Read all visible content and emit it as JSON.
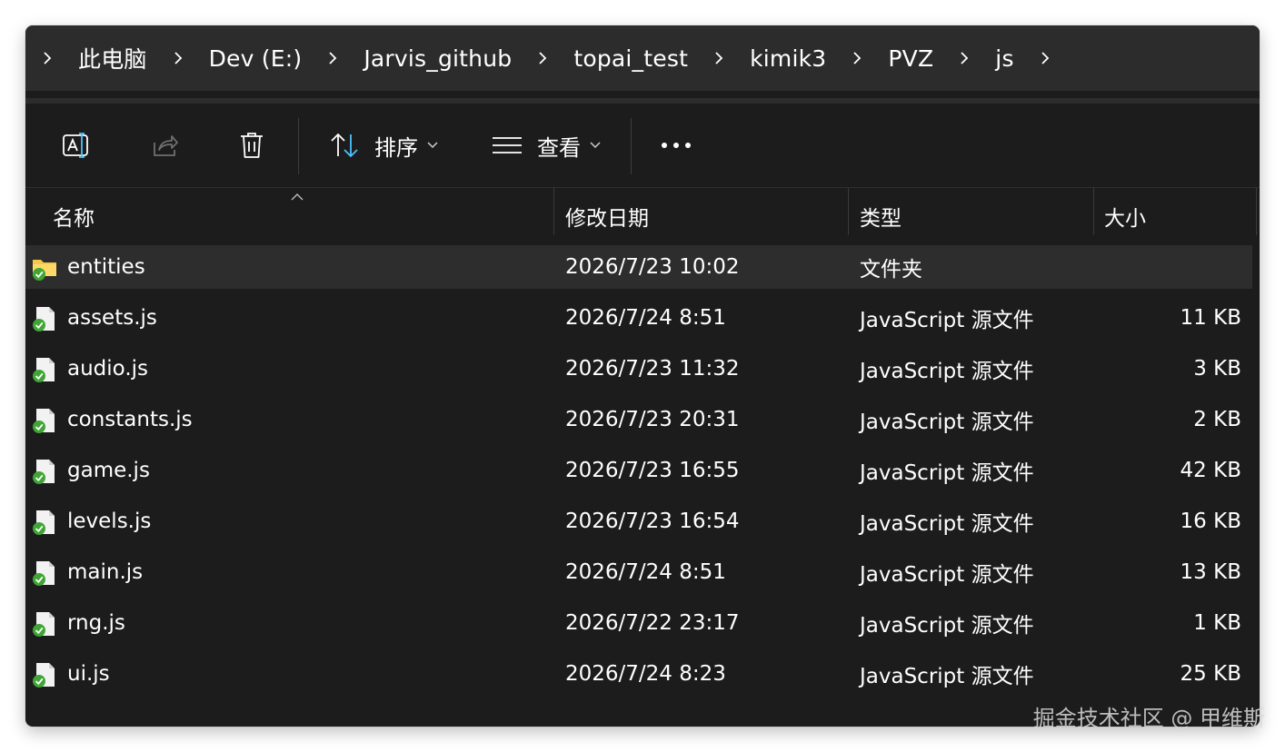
{
  "breadcrumb": {
    "items": [
      {
        "label": "此电脑"
      },
      {
        "label": "Dev (E:)"
      },
      {
        "label": "Jarvis_github"
      },
      {
        "label": "topai_test"
      },
      {
        "label": "kimik3"
      },
      {
        "label": "PVZ"
      },
      {
        "label": "js"
      }
    ]
  },
  "toolbar": {
    "rename_icon": "rename-icon",
    "share_icon": "share-icon",
    "delete_icon": "trash-icon",
    "sort_label": "排序",
    "view_label": "查看",
    "more_icon": "more-horizontal-icon"
  },
  "columns": {
    "name": "名称",
    "date": "修改日期",
    "type": "类型",
    "size": "大小"
  },
  "files": [
    {
      "name": "entities",
      "date": "2026/7/23 10:02",
      "type": "文件夹",
      "size": "",
      "icon": "folder-icon",
      "selected": true
    },
    {
      "name": "assets.js",
      "date": "2026/7/24 8:51",
      "type": "JavaScript 源文件",
      "size": "11 KB",
      "icon": "js-file-icon",
      "selected": false
    },
    {
      "name": "audio.js",
      "date": "2026/7/23 11:32",
      "type": "JavaScript 源文件",
      "size": "3 KB",
      "icon": "js-file-icon",
      "selected": false
    },
    {
      "name": "constants.js",
      "date": "2026/7/23 20:31",
      "type": "JavaScript 源文件",
      "size": "2 KB",
      "icon": "js-file-icon",
      "selected": false
    },
    {
      "name": "game.js",
      "date": "2026/7/23 16:55",
      "type": "JavaScript 源文件",
      "size": "42 KB",
      "icon": "js-file-icon",
      "selected": false
    },
    {
      "name": "levels.js",
      "date": "2026/7/23 16:54",
      "type": "JavaScript 源文件",
      "size": "16 KB",
      "icon": "js-file-icon",
      "selected": false
    },
    {
      "name": "main.js",
      "date": "2026/7/24 8:51",
      "type": "JavaScript 源文件",
      "size": "13 KB",
      "icon": "js-file-icon",
      "selected": false
    },
    {
      "name": "rng.js",
      "date": "2026/7/22 23:17",
      "type": "JavaScript 源文件",
      "size": "1 KB",
      "icon": "js-file-icon",
      "selected": false
    },
    {
      "name": "ui.js",
      "date": "2026/7/24 8:23",
      "type": "JavaScript 源文件",
      "size": "25 KB",
      "icon": "js-file-icon",
      "selected": false
    }
  ],
  "watermark": "掘金技术社区 @ 甲维斯",
  "colors": {
    "window_bg": "#1c1c1c",
    "titlebar_bg": "#2c2c2c",
    "selected_row": "#2d2d2d",
    "folder_yellow": "#f5c84a",
    "sync_green": "#3fa535",
    "accent_blue": "#4cc2ff"
  }
}
